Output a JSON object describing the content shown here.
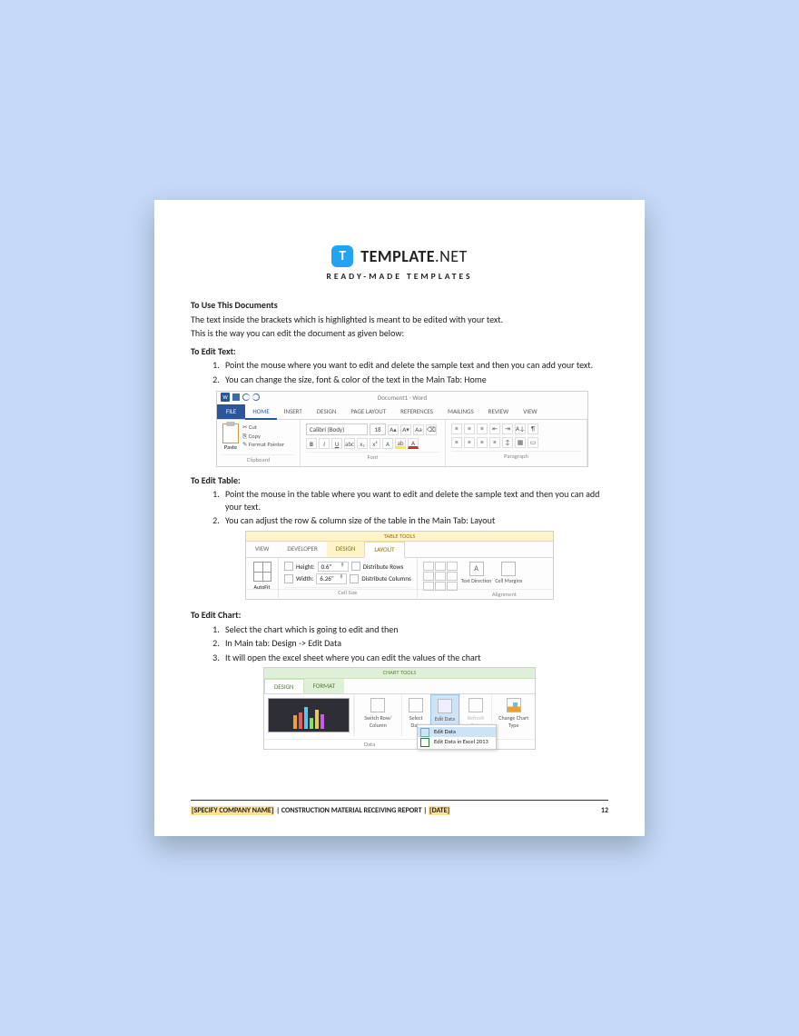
{
  "brand": {
    "name": "TEMPLATE",
    "suffix": ".NET",
    "tagline": "READY-MADE TEMPLATES",
    "icon_letter": "T"
  },
  "section1": {
    "heading": "To Use This Documents",
    "p1": "The text inside the brackets which is highlighted is meant to be edited with your text.",
    "p2": "This is the way you can edit the document as given below:"
  },
  "edit_text": {
    "heading": "To Edit Text:",
    "items": [
      "Point the mouse where you want to edit and delete the sample text and then you can add your text.",
      "You can change the size, font & color of the text in the Main Tab: Home"
    ]
  },
  "ribbon1": {
    "title": "Document1 - Word",
    "tabs": [
      "FILE",
      "HOME",
      "INSERT",
      "DESIGN",
      "PAGE LAYOUT",
      "REFERENCES",
      "MAILINGS",
      "REVIEW",
      "VIEW"
    ],
    "clipboard": {
      "cut": "Cut",
      "copy": "Copy",
      "fmt": "Format Painter",
      "paste": "Paste",
      "group": "Clipboard"
    },
    "font": {
      "name": "Calibri (Body)",
      "size": "18",
      "group": "Font"
    },
    "paragraph": {
      "group": "Paragraph"
    }
  },
  "edit_table": {
    "heading": "To Edit Table:",
    "items": [
      "Point the mouse in the table where you want to edit and delete the sample text and then you can add your text.",
      "You can adjust the row & column size of the table in the Main Tab: Layout"
    ]
  },
  "ribbon2": {
    "context": "TABLE TOOLS",
    "tabs": [
      "VIEW",
      "DEVELOPER",
      "DESIGN",
      "LAYOUT"
    ],
    "autofit": "AutoFit",
    "height_label": "Height:",
    "height_val": "0.6\"",
    "width_label": "Width:",
    "width_val": "6.26\"",
    "dist_rows": "Distribute Rows",
    "dist_cols": "Distribute Columns",
    "cellsize": "Cell Size",
    "text_dir": "Text Direction",
    "cell_marg": "Cell Margins",
    "alignment": "Alignment"
  },
  "edit_chart": {
    "heading": "To Edit Chart:",
    "items": [
      "Select the chart which is going to edit and then",
      "In Main tab: Design -> Edit Data",
      "It will open the excel sheet where you can edit the values of the chart"
    ]
  },
  "ribbon3": {
    "context": "CHART TOOLS",
    "tabs": [
      "DESIGN",
      "FORMAT"
    ],
    "switch": "Switch Row/\nColumn",
    "select": "Select\nData",
    "edit": "Edit\nData",
    "refresh": "Refresh\nData",
    "change": "Change\nChart Type",
    "data_group": "Data",
    "menu": {
      "item1": "Edit Data",
      "item2": "Edit Data in Excel 2013"
    }
  },
  "footer": {
    "company": "[SPECIFY COMPANY NAME]",
    "sep": " | ",
    "title": "CONSTRUCTION MATERIAL RECEIVING REPORT",
    "date": "[DATE]",
    "page": "12"
  }
}
